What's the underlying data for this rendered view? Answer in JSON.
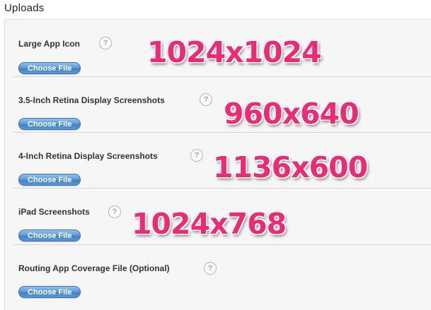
{
  "section": {
    "title": "Uploads"
  },
  "uploads": [
    {
      "label": "Large App Icon",
      "button": "Choose File",
      "help": "?",
      "dimension": "1024x1024"
    },
    {
      "label": "3.5-Inch Retina Display Screenshots",
      "button": "Choose File",
      "help": "?",
      "dimension": "960x640"
    },
    {
      "label": "4-Inch Retina Display Screenshots",
      "button": "Choose File",
      "help": "?",
      "dimension": "1136x600"
    },
    {
      "label": "iPad Screenshots",
      "button": "Choose File",
      "help": "?",
      "dimension": "1024x768"
    },
    {
      "label": "Routing App Coverage File (Optional)",
      "button": "Choose File",
      "help": "?",
      "dimension": ""
    }
  ],
  "colors": {
    "annotation": "#ee2a74",
    "button": "#4a8bd0",
    "panel": "#f6f6f6"
  },
  "icons": {
    "help": "question-mark-circle-icon"
  }
}
